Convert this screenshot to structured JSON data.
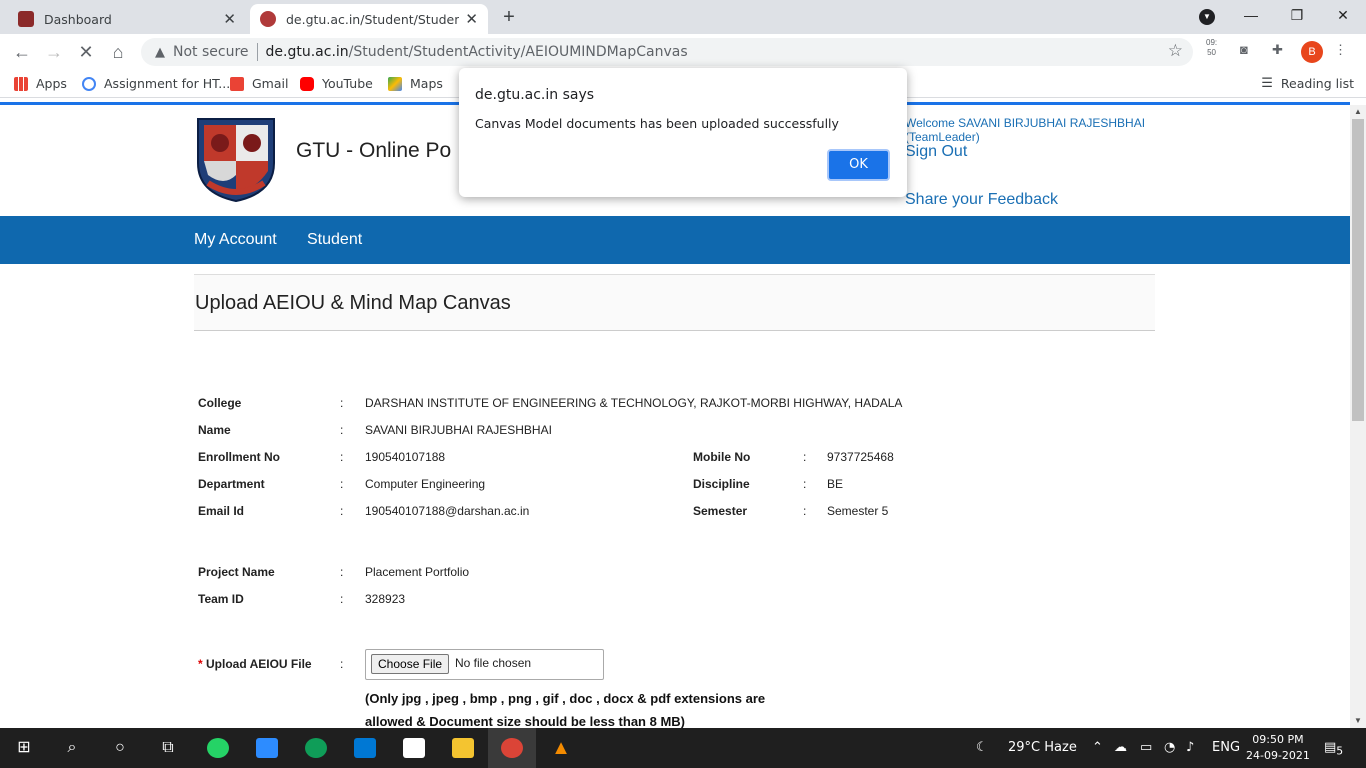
{
  "browser": {
    "tabs": [
      {
        "title": "Dashboard",
        "active": false
      },
      {
        "title": "de.gtu.ac.in/Student/StudentActi",
        "active": true
      }
    ],
    "new_tab": "+",
    "omnibox": {
      "security": "Not secure",
      "domain": "de.gtu.ac.in",
      "path": "/Student/StudentActivity/AEIOUMINDMapCanvas"
    },
    "clock_ext": "09:\n50",
    "profile_initial": "B",
    "bookmarks": [
      "Apps",
      "Assignment for HT...",
      "Gmail",
      "YouTube",
      "Maps"
    ],
    "reading_list": "Reading list"
  },
  "header": {
    "site_title": "GTU - Online Po",
    "welcome": "Welcome SAVANI BIRJUBHAI RAJESHBHAI",
    "role": "(TeamLeader)",
    "sign_out": "Sign Out",
    "feedback": "Share your Feedback"
  },
  "nav": {
    "items": [
      "My Account",
      "Student"
    ]
  },
  "section_title": "Upload AEIOU & Mind Map Canvas",
  "student": {
    "college_label": "College",
    "college": "DARSHAN INSTITUTE OF ENGINEERING & TECHNOLOGY, RAJKOT-MORBI HIGHWAY, HADALA",
    "name_label": "Name",
    "name": "SAVANI BIRJUBHAI RAJESHBHAI",
    "enrollment_label": "Enrollment No",
    "enrollment": "190540107188",
    "mobile_label": "Mobile No",
    "mobile": "9737725468",
    "department_label": "Department",
    "department": "Computer Engineering",
    "discipline_label": "Discipline",
    "discipline": "BE",
    "email_label": "Email Id",
    "email": "190540107188@darshan.ac.in",
    "semester_label": "Semester",
    "semester": "Semester 5",
    "project_label": "Project Name",
    "project": "Placement Portfolio",
    "team_label": "Team ID",
    "team": "328923",
    "colon": ":"
  },
  "upload": {
    "required_mark": "*",
    "label": "Upload AEIOU File",
    "choose_button": "Choose File",
    "no_file": "No file chosen",
    "note_line1": "(Only jpg , jpeg , bmp , png , gif , doc , docx & pdf extensions are",
    "note_line2": "allowed & Document size should be less than 8 MB)"
  },
  "dialog": {
    "title": "de.gtu.ac.in says",
    "message": "Canvas Model documents has been uploaded successfully",
    "ok": "OK"
  },
  "taskbar": {
    "weather": "29°C  Haze",
    "language": "ENG",
    "time": "09:50 PM",
    "date": "24-09-2021",
    "notifications": "5"
  }
}
